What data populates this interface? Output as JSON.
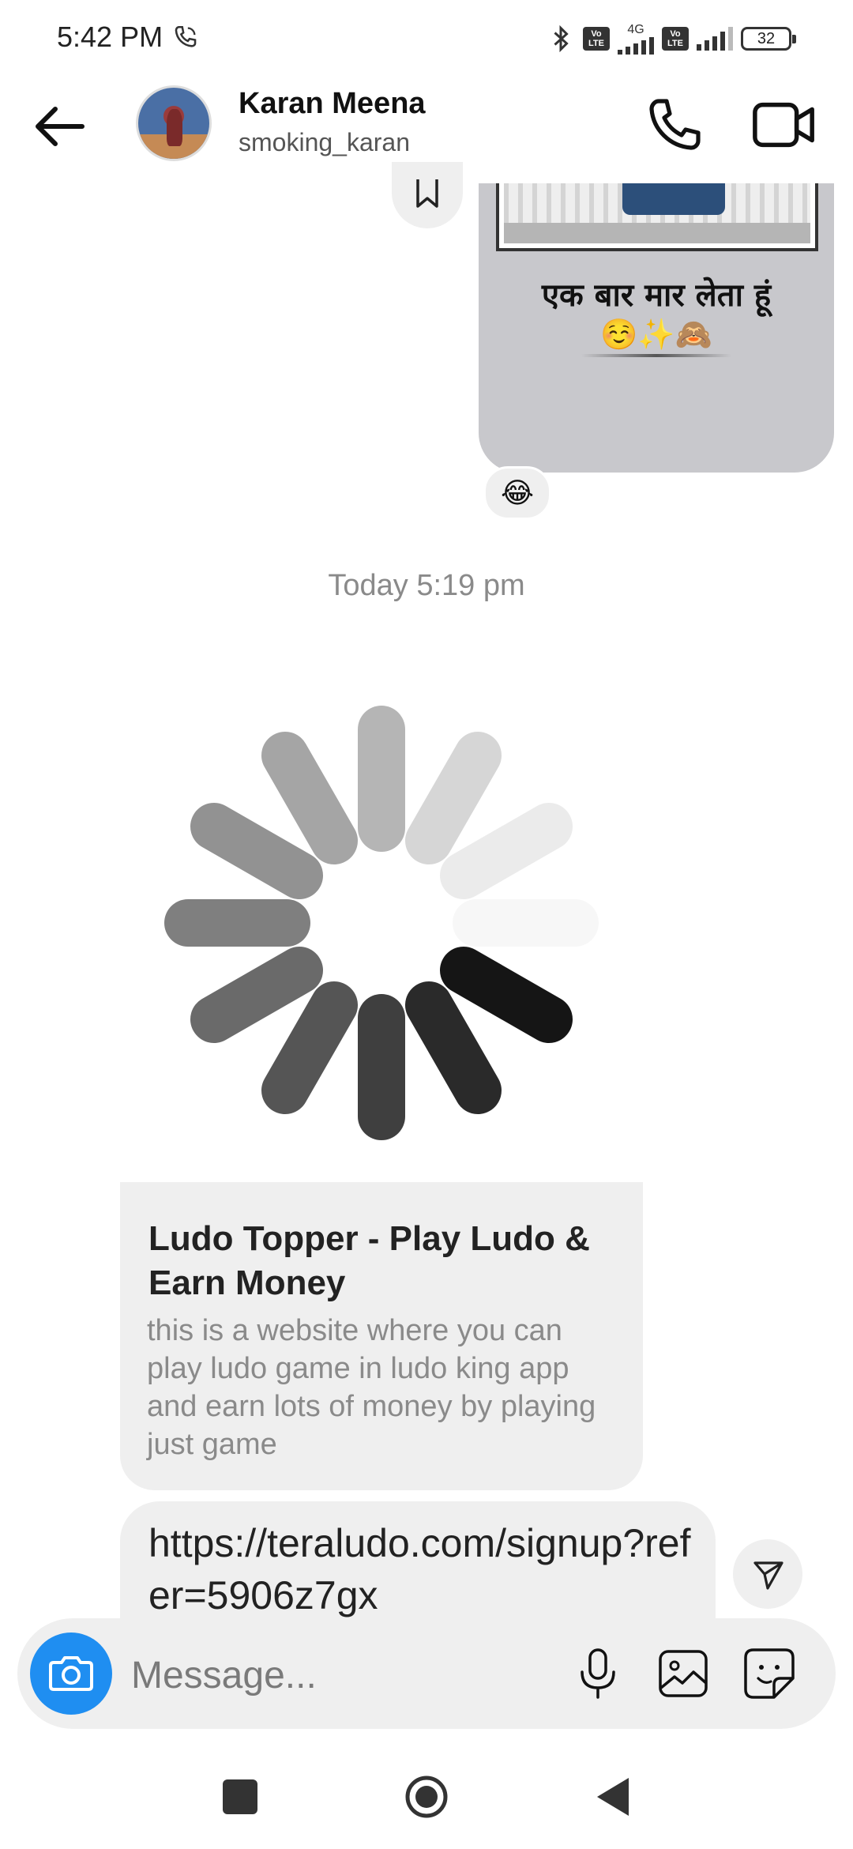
{
  "status_bar": {
    "time": "5:42 PM",
    "network_type": "4G",
    "volte_label": "Vo LTE",
    "battery_level": "32"
  },
  "header": {
    "contact_name": "Karan Meena",
    "contact_username": "smoking_karan"
  },
  "shared_post": {
    "caption": "एक बार मार लेता हूं",
    "emojis": "☺️✨🙈",
    "reaction": "😂"
  },
  "timestamp": "Today 5:19 pm",
  "link_preview": {
    "title": "Ludo Topper - Play Ludo & Earn Money",
    "description": "this is a website where you can play ludo game in ludo king app and earn lots of money by playing just game"
  },
  "link_message": {
    "url": "https://teraludo.com/signup?refer=5906z7gx"
  },
  "composer": {
    "placeholder": "Message..."
  },
  "colors": {
    "accent": "#1f8ef1",
    "bubble": "#efefef",
    "muted_text": "#8a8a8a"
  },
  "icons": {
    "back": "arrow-left-icon",
    "call": "phone-icon",
    "video": "video-camera-icon",
    "save": "bookmark-icon",
    "camera": "camera-icon",
    "mic": "microphone-icon",
    "gallery": "image-icon",
    "sticker": "sticker-icon",
    "share": "send-icon"
  }
}
